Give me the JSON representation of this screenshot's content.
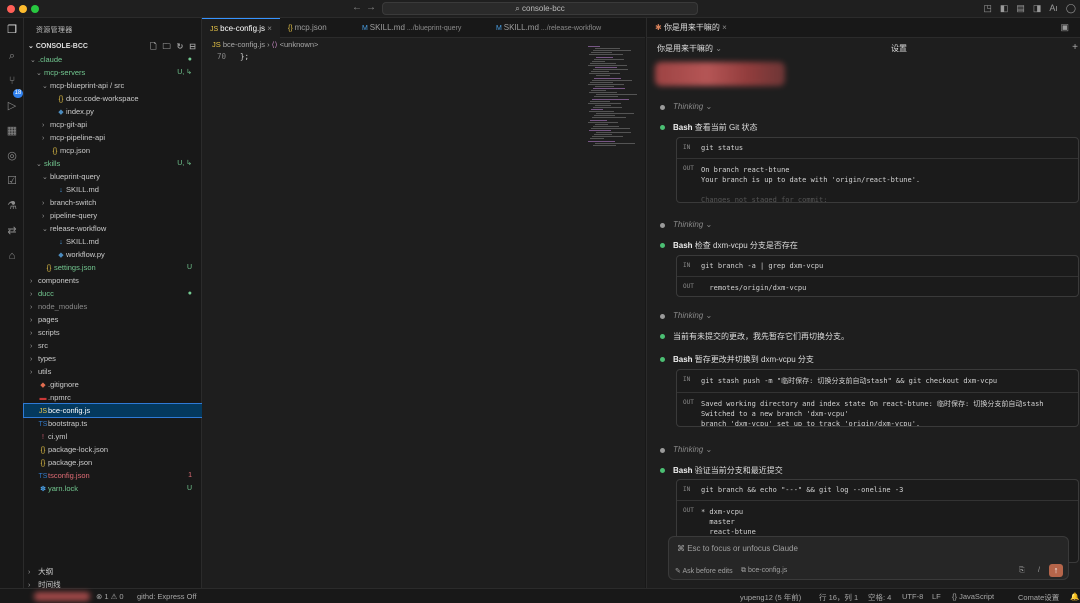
{
  "window": {
    "title": "console-bcc",
    "traffic_colors": [
      "#ff5f57",
      "#febc2e",
      "#28c840"
    ]
  },
  "activity": {
    "badge": "18",
    "icons": [
      "explorer-icon",
      "search-icon",
      "source-control-icon",
      "run-debug-icon",
      "extensions-icon",
      "browser-icon",
      "tasks-icon",
      "flask-icon",
      "remote-icon",
      "package-icon"
    ]
  },
  "sidebar": {
    "title": "资源管理器",
    "project": "CONSOLE-BCC",
    "tree": [
      {
        "label": ".claude",
        "depth": 0,
        "kind": "folder-open",
        "status": "●",
        "cls": "git-mod"
      },
      {
        "label": "mcp-servers",
        "depth": 1,
        "kind": "folder-open",
        "status": "U, ↳",
        "cls": "git-mod"
      },
      {
        "label": "mcp-blueprint-api / src",
        "depth": 2,
        "kind": "folder-open",
        "status": "",
        "cls": ""
      },
      {
        "label": "ducc.code-workspace",
        "depth": 3,
        "kind": "json",
        "status": "",
        "cls": ""
      },
      {
        "label": "index.py",
        "depth": 3,
        "kind": "py",
        "status": "",
        "cls": ""
      },
      {
        "label": "mcp-git-api",
        "depth": 2,
        "kind": "folder",
        "status": "",
        "cls": ""
      },
      {
        "label": "mcp-pipeline-api",
        "depth": 2,
        "kind": "folder",
        "status": "",
        "cls": ""
      },
      {
        "label": "mcp.json",
        "depth": 2,
        "kind": "json",
        "status": "",
        "cls": ""
      },
      {
        "label": "skills",
        "depth": 1,
        "kind": "folder-open",
        "status": "U, ↳",
        "cls": "git-mod"
      },
      {
        "label": "blueprint-query",
        "depth": 2,
        "kind": "folder-open",
        "status": "",
        "cls": ""
      },
      {
        "label": "SKILL.md",
        "depth": 3,
        "kind": "md",
        "status": "",
        "cls": ""
      },
      {
        "label": "branch-switch",
        "depth": 2,
        "kind": "folder",
        "status": "",
        "cls": ""
      },
      {
        "label": "pipeline-query",
        "depth": 2,
        "kind": "folder",
        "status": "",
        "cls": ""
      },
      {
        "label": "release-workflow",
        "depth": 2,
        "kind": "folder-open",
        "status": "",
        "cls": ""
      },
      {
        "label": "SKILL.md",
        "depth": 3,
        "kind": "md",
        "status": "",
        "cls": ""
      },
      {
        "label": "workflow.py",
        "depth": 3,
        "kind": "py",
        "status": "",
        "cls": ""
      },
      {
        "label": "settings.json",
        "depth": 1,
        "kind": "json",
        "status": "U",
        "cls": "git-mod"
      },
      {
        "label": "components",
        "depth": 0,
        "kind": "folder",
        "status": "",
        "cls": ""
      },
      {
        "label": "ducc",
        "depth": 0,
        "kind": "folder",
        "status": "●",
        "cls": "git-mod"
      },
      {
        "label": "node_modules",
        "depth": 0,
        "kind": "folder",
        "status": "",
        "cls": "dim"
      },
      {
        "label": "pages",
        "depth": 0,
        "kind": "folder",
        "status": "",
        "cls": ""
      },
      {
        "label": "scripts",
        "depth": 0,
        "kind": "folder",
        "status": "",
        "cls": ""
      },
      {
        "label": "src",
        "depth": 0,
        "kind": "folder",
        "status": "",
        "cls": ""
      },
      {
        "label": "types",
        "depth": 0,
        "kind": "folder",
        "status": "",
        "cls": ""
      },
      {
        "label": "utils",
        "depth": 0,
        "kind": "folder",
        "status": "",
        "cls": ""
      },
      {
        "label": ".gitignore",
        "depth": 0,
        "kind": "git",
        "status": "",
        "cls": ""
      },
      {
        "label": ".npmrc",
        "depth": 0,
        "kind": "npm",
        "status": "",
        "cls": ""
      },
      {
        "label": "bce-config.js",
        "depth": 0,
        "kind": "js",
        "status": "",
        "cls": "",
        "selected": true
      },
      {
        "label": "bootstrap.ts",
        "depth": 0,
        "kind": "ts",
        "status": "",
        "cls": ""
      },
      {
        "label": "ci.yml",
        "depth": 0,
        "kind": "yml",
        "status": "",
        "cls": ""
      },
      {
        "label": "package-lock.json",
        "depth": 0,
        "kind": "json",
        "status": "",
        "cls": ""
      },
      {
        "label": "package.json",
        "depth": 0,
        "kind": "json",
        "status": "",
        "cls": ""
      },
      {
        "label": "tsconfig.json",
        "depth": 0,
        "kind": "tsconfig",
        "status": "1",
        "cls": "git-err"
      },
      {
        "label": "yarn.lock",
        "depth": 0,
        "kind": "yarn",
        "status": "U",
        "cls": "git-mod"
      }
    ],
    "outline": "大纲",
    "timeline": "时间线"
  },
  "editor": {
    "tabs": [
      {
        "icon": "JS",
        "label": "bce-config.js",
        "hint": "",
        "active": true
      },
      {
        "icon": "{}",
        "label": "mcp.json",
        "hint": "",
        "active": false
      },
      {
        "icon": "M",
        "label": "SKILL.md",
        "hint": ".../blueprint-query",
        "active": false
      },
      {
        "icon": "M",
        "label": "SKILL.md",
        "hint": ".../release-workflow",
        "active": false
      }
    ],
    "breadcrumb": {
      "file": "bce-config.js",
      "sep": "›",
      "symbol": "<unknown>"
    },
    "code": [
      {
        "ln": "70",
        "text": "};"
      }
    ]
  },
  "panel": {
    "tab_title": "你是用来干嘛的",
    "header_title": "你是用来干嘛的",
    "settings": "设置",
    "events": [
      {
        "type": "thinking",
        "label": "Thinking"
      },
      {
        "type": "bash",
        "label": "Bash",
        "desc": "查看当前 Git 状态",
        "in": "git status",
        "out": [
          "On branch react-btune",
          "Your branch is up to date with 'origin/react-btune'.",
          "",
          "Changes not staged for commit:"
        ]
      },
      {
        "type": "thinking",
        "label": "Thinking"
      },
      {
        "type": "bash",
        "label": "Bash",
        "desc": "检查 dxm-vcpu 分支是否存在",
        "in": "git branch -a | grep dxm-vcpu",
        "out": [
          "  remotes/origin/dxm-vcpu"
        ]
      },
      {
        "type": "thinking",
        "label": "Thinking"
      },
      {
        "type": "text",
        "text": "当前有未提交的更改，我先暂存它们再切换分支。"
      },
      {
        "type": "bash",
        "label": "Bash",
        "desc": "暂存更改并切换到 dxm-vcpu 分支",
        "in": "git stash push -m \"临时保存: 切换分支前自动stash\" && git checkout dxm-vcpu",
        "out": [
          "Saved working directory and index state On react-btune: 临时保存: 切换分支前自动stash",
          "Switched to a new branch 'dxm-vcpu'",
          "branch 'dxm-vcpu' set up to track 'origin/dxm-vcpu'."
        ]
      },
      {
        "type": "thinking",
        "label": "Thinking"
      },
      {
        "type": "bash",
        "label": "Bash",
        "desc": "验证当前分支和最近提交",
        "in": "git branch && echo \"---\" && git log --oneline -3",
        "out": [
          "* dxm-vcpu",
          "  master",
          "  react-btune"
        ]
      }
    ],
    "input": {
      "placeholder": "⌘ Esc to focus or unfocus Claude",
      "mode": "Ask before edits",
      "file": "bce-config.js"
    }
  },
  "statusbar": {
    "errors": "⊗ 1 ⚠ 0",
    "githd": "githd: Express Off",
    "author": "yupeng12 (5 年前)",
    "position": "行 16，列 1",
    "spaces": "空格: 4",
    "encoding": "UTF-8",
    "eol": "LF",
    "language": "{} JavaScript",
    "settings": "Comate设置"
  }
}
